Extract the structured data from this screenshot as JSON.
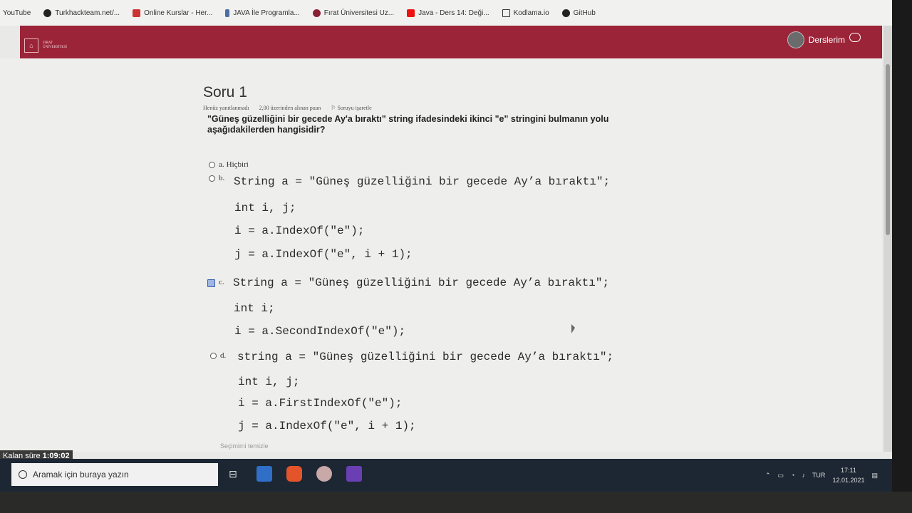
{
  "bookmarks": [
    {
      "label": "YouTube",
      "icon": "youtube-icon"
    },
    {
      "label": "Turkhackteam.net/...",
      "icon": "turkhack-icon"
    },
    {
      "label": "Online Kurslar - Her...",
      "icon": "udemy-icon"
    },
    {
      "label": "JAVA İle Programla...",
      "icon": "java-icon"
    },
    {
      "label": "Fırat Üniversitesi Uz...",
      "icon": "firat-icon"
    },
    {
      "label": "Java - Ders 14: Deği...",
      "icon": "youtube-icon"
    },
    {
      "label": "Kodlama.io",
      "icon": "kodlama-icon"
    },
    {
      "label": "GitHub",
      "icon": "github-icon"
    }
  ],
  "header": {
    "logo_line1": "FIRAT",
    "logo_line2": "ÜNİVERSİTESİ",
    "user_menu_label": "Derslerim",
    "brand_color": "#9b2438"
  },
  "question": {
    "title": "Soru 1",
    "status": "Henüz yanıtlanmadı",
    "points": "2,00 üzerinden alınan puan",
    "flag_label": "Soruyu işaretle",
    "text": "\"Güneş güzelliğini bir gecede Ay'a bıraktı\" string ifadesindeki ikinci \"e\" stringini bulmanın yolu aşağıdakilerden hangisidir?",
    "options": [
      {
        "label": "a.",
        "text": "Hiçbiri",
        "selected": false,
        "code": []
      },
      {
        "label": "b.",
        "text": "",
        "selected": false,
        "code": [
          "String a = \"Güneş güzelliğini bir gecede Ay’a bıraktı\";",
          "int i, j;",
          "i = a.IndexOf(\"e\");",
          "j = a.IndexOf(\"e\", i + 1);"
        ]
      },
      {
        "label": "c.",
        "text": "",
        "selected": true,
        "code": [
          "String a = \"Güneş güzelliğini bir gecede Ay’a bıraktı\";",
          "int i;",
          "i = a.SecondIndexOf(\"e\");"
        ]
      },
      {
        "label": "d.",
        "text": "",
        "selected": false,
        "code": [
          "string a = \"Güneş güzelliğini bir gecede Ay’a bıraktı\";",
          "int i, j;",
          "i = a.FirstIndexOf(\"e\");",
          "j = a.IndexOf(\"e\", i + 1);"
        ]
      }
    ],
    "clear_label": "Seçimimi temizle"
  },
  "timer": {
    "label": "Kalan süre",
    "value": "1:09:02"
  },
  "taskbar": {
    "search_placeholder": "Aramak için buraya yazın",
    "apps": [
      "task-view-icon",
      "mail-icon",
      "brave-icon",
      "app-icon",
      "visual-studio-icon"
    ],
    "language": "TUR",
    "time": "17:11",
    "date": "12.01.2021"
  }
}
